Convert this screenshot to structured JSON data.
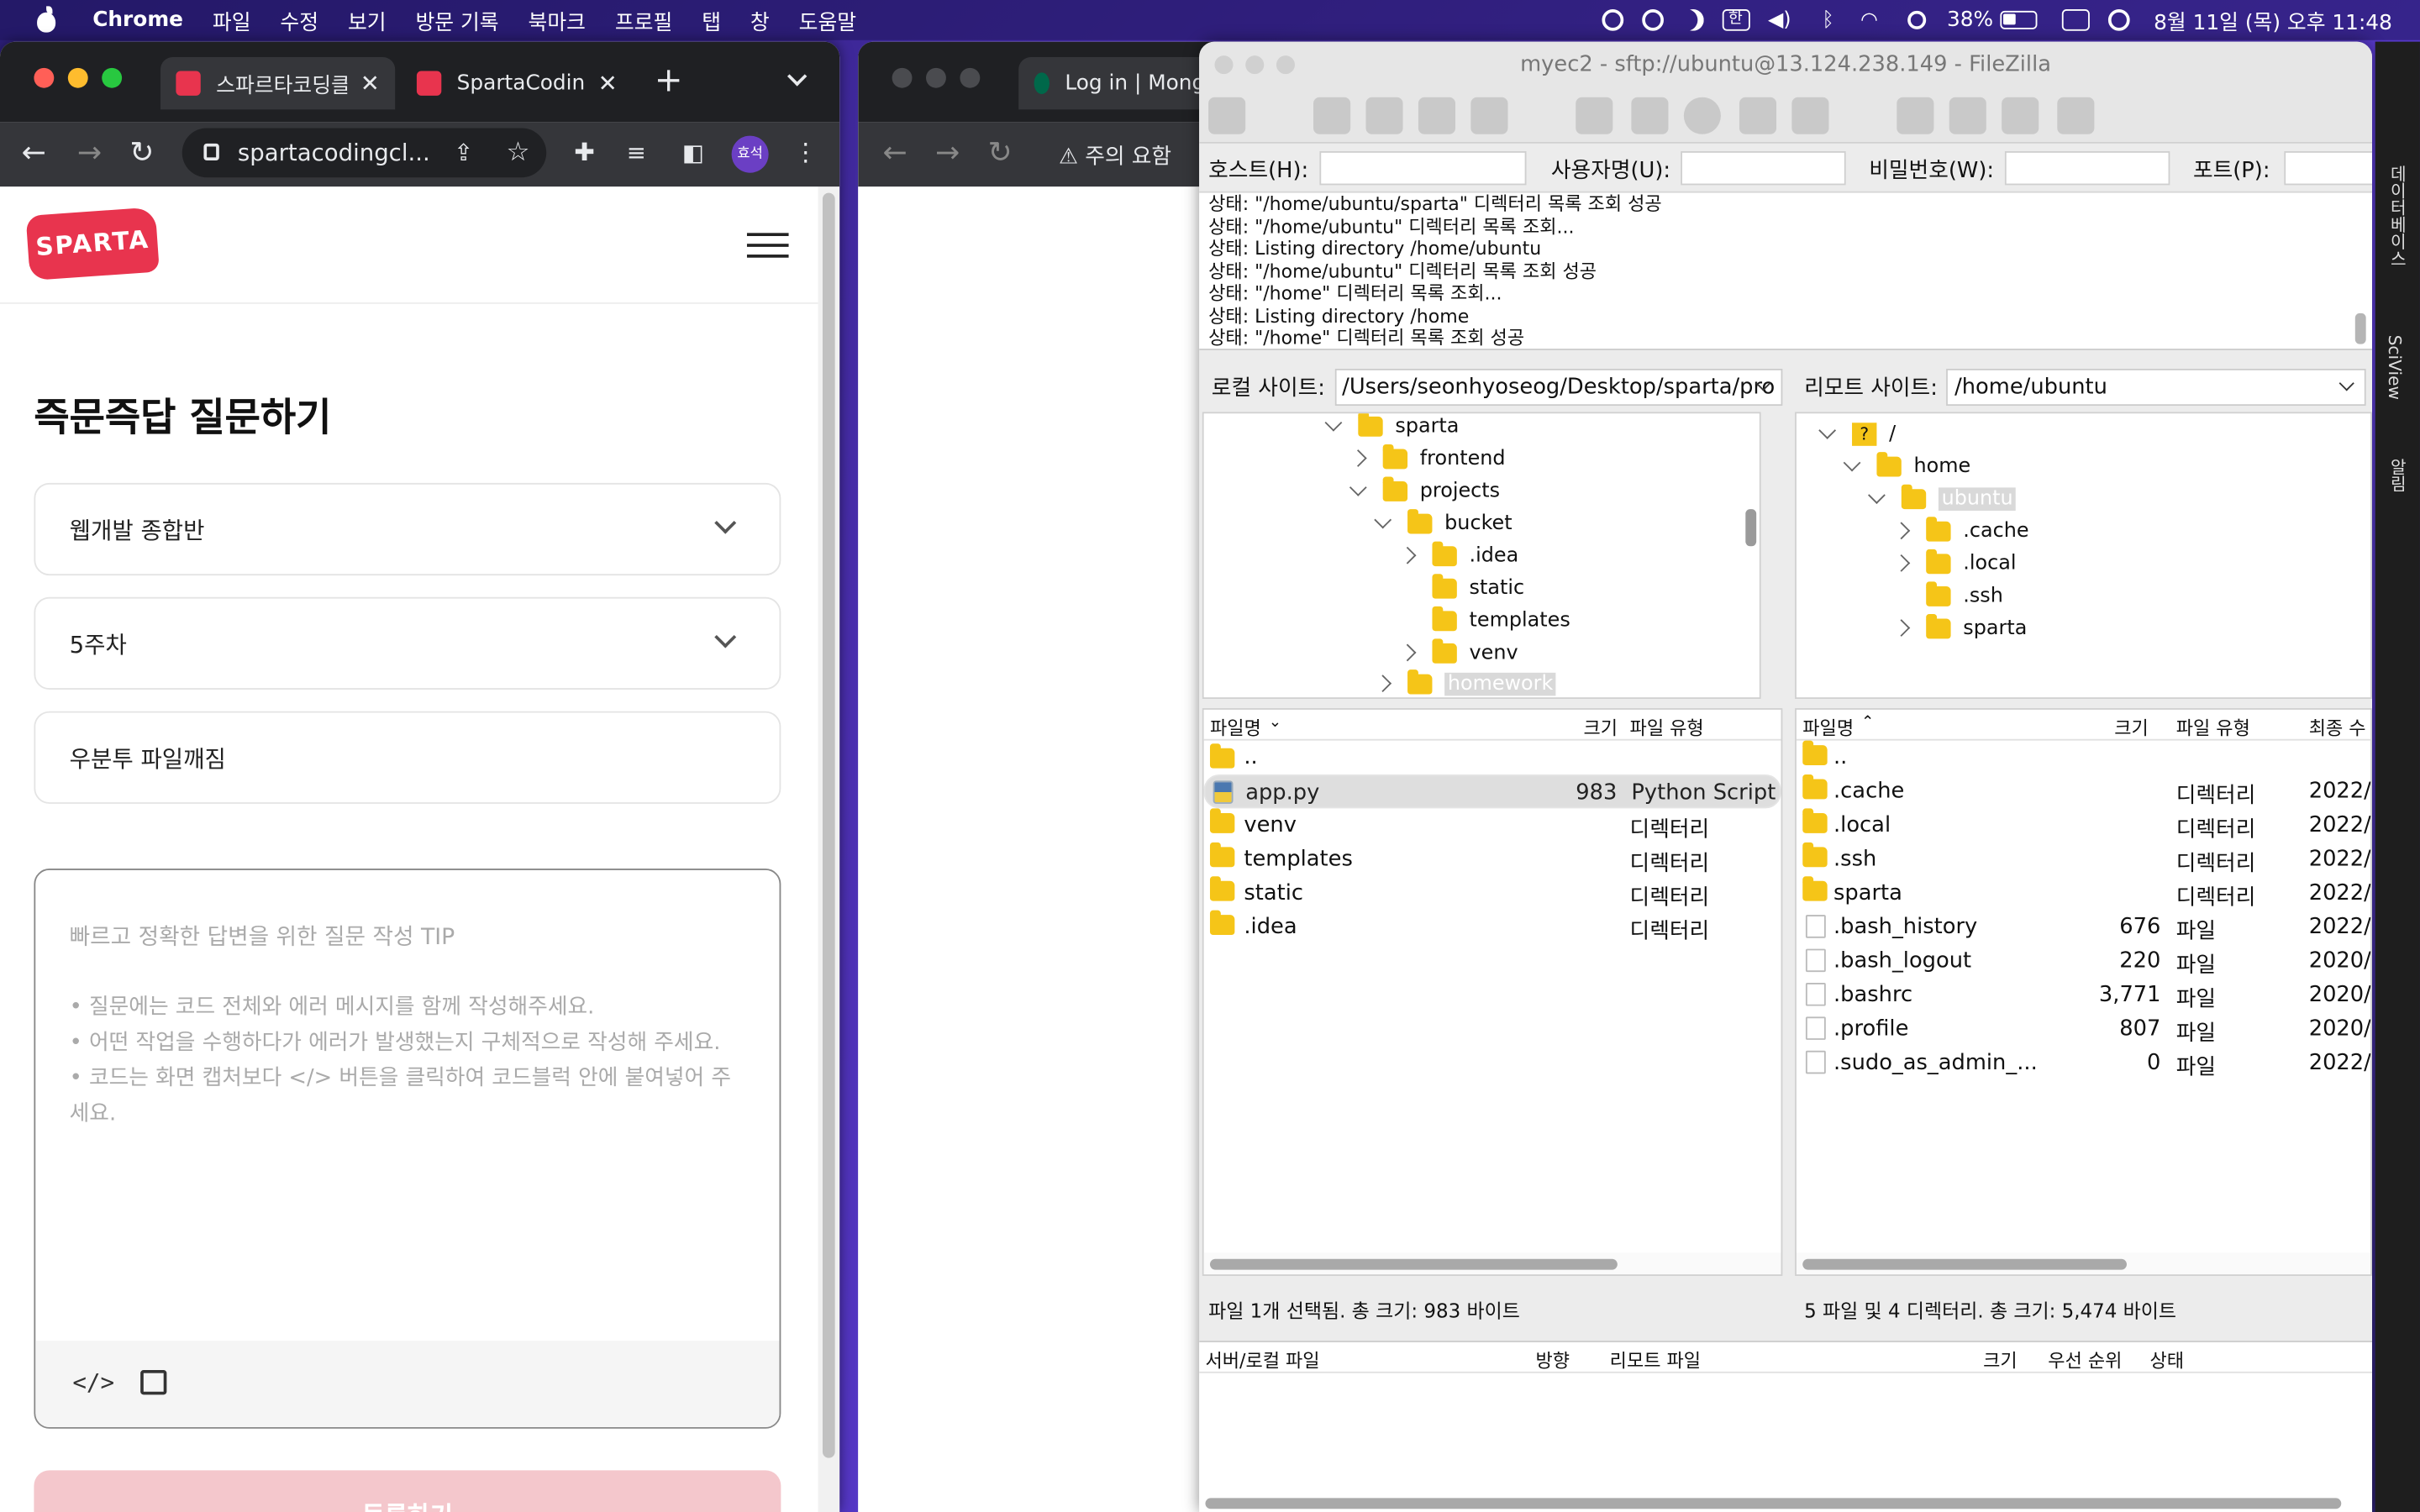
{
  "menubar": {
    "app": "Chrome",
    "items": [
      "파일",
      "수정",
      "보기",
      "방문 기록",
      "북마크",
      "프로필",
      "탭",
      "창",
      "도움말"
    ],
    "battery": "38%",
    "clock": "8월 11일 (목) 오후 11:48",
    "ime": "한"
  },
  "chrome_left": {
    "tabs": [
      {
        "title": "스파르타코딩클럽",
        "favicon_color": "#e8344e"
      },
      {
        "title": "SpartaCoding",
        "favicon_color": "#e8344e"
      }
    ],
    "url": "spartacodingcl...",
    "profile": "효석"
  },
  "sparta_page": {
    "logo": "SPARTA",
    "title": "즉문즉답 질문하기",
    "course_select": "웹개발 종합반",
    "week_select": "5주차",
    "question_title": "우분투 파일깨짐",
    "body_placeholder": "빠르고 정확한 답변을 위한 질문 작성 TIP",
    "tips": [
      "• 질문에는 코드 전체와 에러 메시지를 함께 작성해주세요.",
      "• 어떤 작업을 수행하다가 에러가 발생했는지 구체적으로 작성해 주세요.",
      "• 코드는 화면 캡처보다 </> 버튼을 클릭하여 코드블럭 안에 붙여넣어 주세요."
    ],
    "code_button": "</>",
    "submit": "등록하기"
  },
  "chrome_mid": {
    "tab_title": "Log in | Mong",
    "warning": "주의 요함"
  },
  "filezilla": {
    "title": "myec2 - sftp://ubuntu@13.124.238.149 - FileZilla",
    "quickconnect": {
      "host": "호스트(H):",
      "user": "사용자명(U):",
      "pass": "비밀번호(W):",
      "port": "포트(P):"
    },
    "log": [
      "상태:  \"/home/ubuntu/sparta\" 디렉터리 목록 조회 성공",
      "상태:  \"/home/ubuntu\" 디렉터리 목록 조회...",
      "상태:  Listing directory /home/ubuntu",
      "상태:  \"/home/ubuntu\" 디렉터리 목록 조회 성공",
      "상태:  \"/home\" 디렉터리 목록 조회...",
      "상태:  Listing directory /home",
      "상태:  \"/home\" 디렉터리 목록 조회 성공"
    ],
    "local_label": "로컬 사이트:",
    "local_path": "/Users/seonhyoseog/Desktop/sparta/pro",
    "remote_label": "리모트 사이트:",
    "remote_path": "/home/ubuntu",
    "local_tree": [
      "sparta",
      "frontend",
      "projects",
      "bucket",
      ".idea",
      "static",
      "templates",
      "venv",
      "homework"
    ],
    "remote_tree": [
      "/",
      "home",
      "ubuntu",
      ".cache",
      ".local",
      ".ssh",
      "sparta"
    ],
    "local_cols": {
      "name": "파일명",
      "size": "크기",
      "type": "파일 유형"
    },
    "remote_cols": {
      "name": "파일명",
      "size": "크기",
      "type": "파일 유형",
      "modified": "최종 수"
    },
    "local_files": [
      {
        "name": "..",
        "size": "",
        "type": ""
      },
      {
        "name": "app.py",
        "size": "983",
        "type": "Python Script"
      },
      {
        "name": "venv",
        "size": "",
        "type": "디렉터리"
      },
      {
        "name": "templates",
        "size": "",
        "type": "디렉터리"
      },
      {
        "name": "static",
        "size": "",
        "type": "디렉터리"
      },
      {
        "name": ".idea",
        "size": "",
        "type": "디렉터리"
      }
    ],
    "remote_files": [
      {
        "name": "..",
        "size": "",
        "type": "",
        "date": ""
      },
      {
        "name": ".cache",
        "size": "",
        "type": "디렉터리",
        "date": "2022/"
      },
      {
        "name": ".local",
        "size": "",
        "type": "디렉터리",
        "date": "2022/"
      },
      {
        "name": ".ssh",
        "size": "",
        "type": "디렉터리",
        "date": "2022/"
      },
      {
        "name": "sparta",
        "size": "",
        "type": "디렉터리",
        "date": "2022/"
      },
      {
        "name": ".bash_history",
        "size": "676",
        "type": "파일",
        "date": "2022/"
      },
      {
        "name": ".bash_logout",
        "size": "220",
        "type": "파일",
        "date": "2020/"
      },
      {
        "name": ".bashrc",
        "size": "3,771",
        "type": "파일",
        "date": "2020/"
      },
      {
        "name": ".profile",
        "size": "807",
        "type": "파일",
        "date": "2020/"
      },
      {
        "name": ".sudo_as_admin_...",
        "size": "0",
        "type": "파일",
        "date": "2022/"
      }
    ],
    "local_status": "파일 1개 선택됨. 총 크기: 983 바이트",
    "remote_status": "5 파일 및 4 디렉터리. 총 크기: 5,474 바이트",
    "queue_cols": [
      "서버/로컬 파일",
      "방향",
      "리모트 파일",
      "크기",
      "우선 순위",
      "상태"
    ]
  },
  "side_strip": [
    "데이터베이스",
    "SciView",
    "알림"
  ]
}
